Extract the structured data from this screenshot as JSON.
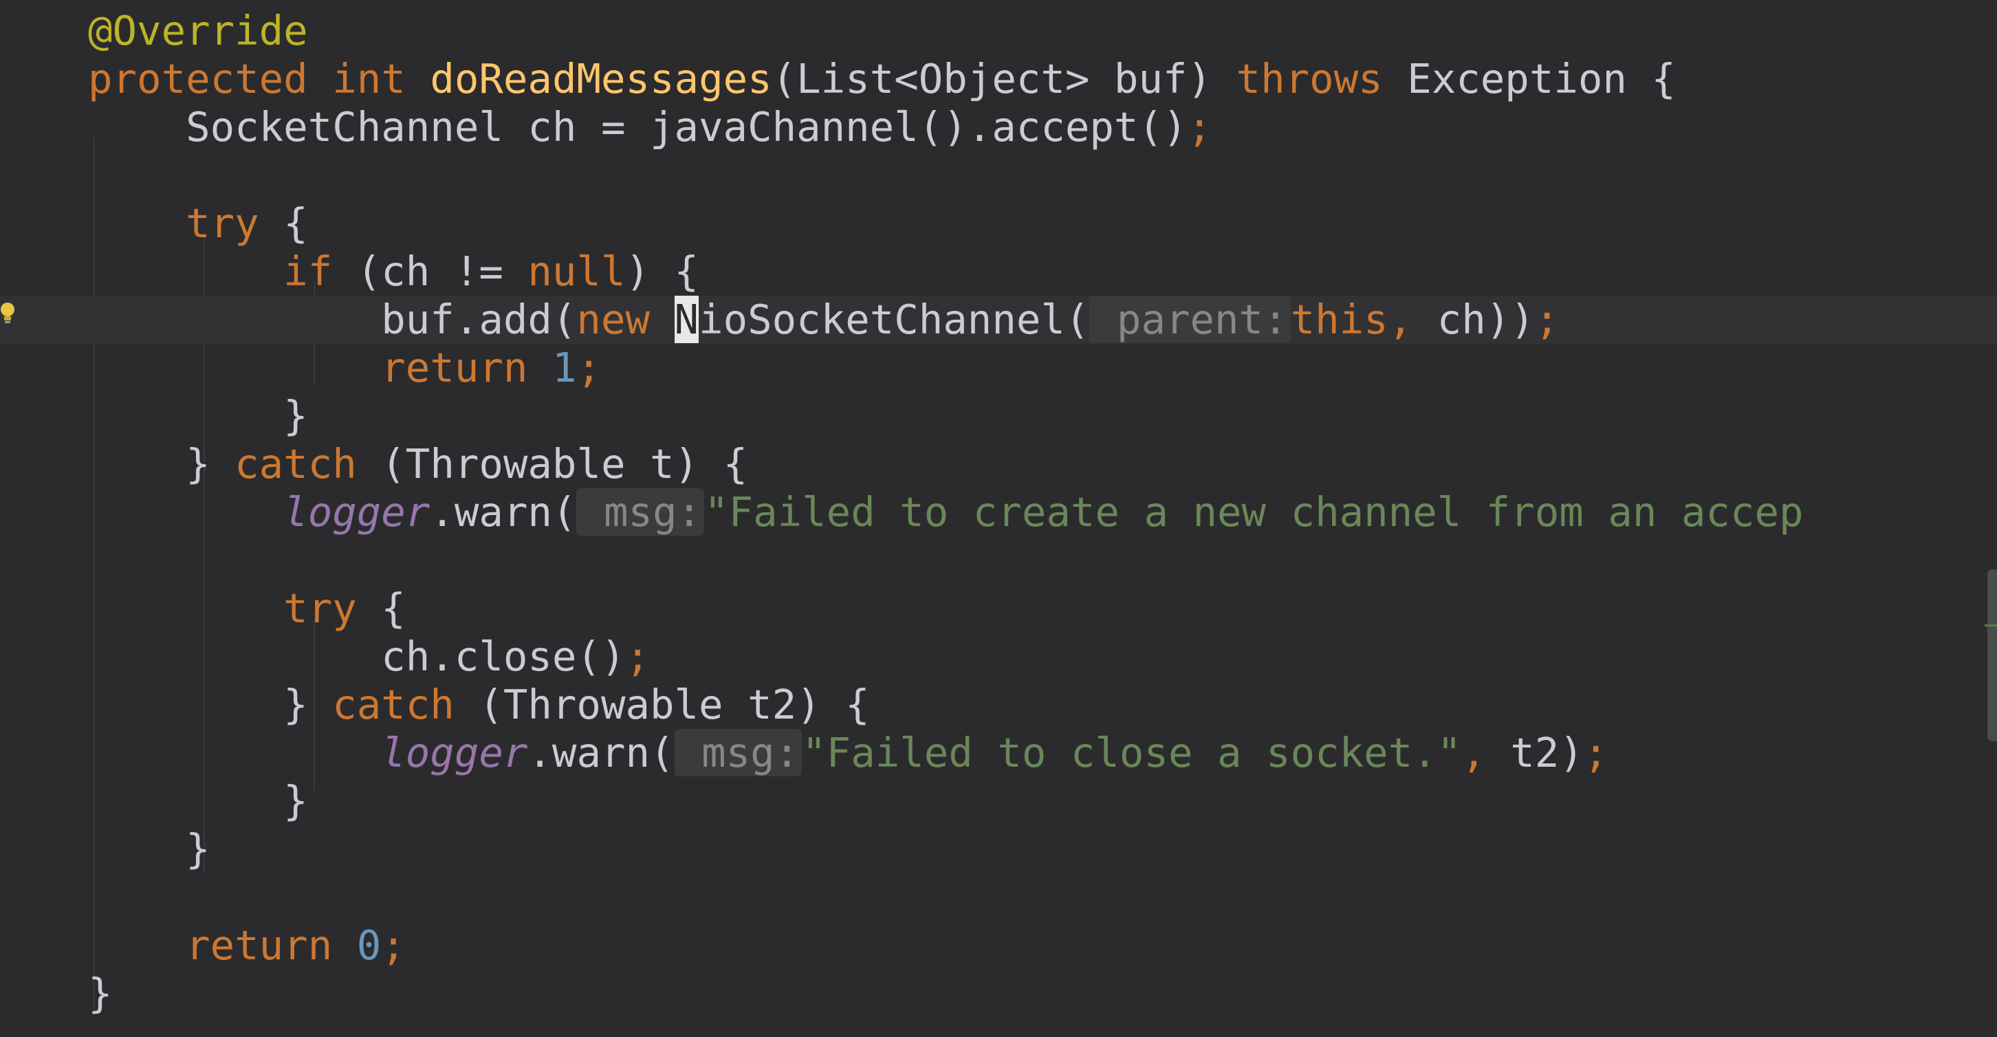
{
  "editor": {
    "language": "Java",
    "lines": [
      {
        "tokens": [
          {
            "text": "@Override",
            "type": "annotation"
          }
        ]
      },
      {
        "tokens": [
          {
            "text": "protected",
            "type": "keyword"
          },
          {
            "text": " ",
            "type": "plain"
          },
          {
            "text": "int",
            "type": "keyword"
          },
          {
            "text": " ",
            "type": "plain"
          },
          {
            "text": "doReadMessages",
            "type": "method-decl"
          },
          {
            "text": "(List<Object> buf) ",
            "type": "plain"
          },
          {
            "text": "throws",
            "type": "keyword"
          },
          {
            "text": " Exception {",
            "type": "plain"
          }
        ]
      },
      {
        "tokens": [
          {
            "text": "    SocketChannel ch = javaChannel().accept()",
            "type": "plain"
          },
          {
            "text": ";",
            "type": "semicolon"
          }
        ]
      },
      {
        "tokens": []
      },
      {
        "tokens": [
          {
            "text": "    ",
            "type": "plain"
          },
          {
            "text": "try",
            "type": "keyword"
          },
          {
            "text": " {",
            "type": "plain"
          }
        ]
      },
      {
        "tokens": [
          {
            "text": "        ",
            "type": "plain"
          },
          {
            "text": "if",
            "type": "keyword"
          },
          {
            "text": " (ch != ",
            "type": "plain"
          },
          {
            "text": "null",
            "type": "keyword"
          },
          {
            "text": ") {",
            "type": "plain"
          }
        ]
      },
      {
        "caret": true,
        "tokens": [
          {
            "text": "            buf.add(",
            "type": "plain"
          },
          {
            "text": "new",
            "type": "keyword"
          },
          {
            "text": " ",
            "type": "plain"
          },
          {
            "text": "N",
            "type": "caret-char"
          },
          {
            "text": "ioSocketChannel(",
            "type": "plain"
          },
          {
            "text": " parent:",
            "type": "param-hint"
          },
          {
            "text": "this",
            "type": "keyword"
          },
          {
            "text": ", ",
            "type": "semicolon"
          },
          {
            "text": "ch))",
            "type": "plain"
          },
          {
            "text": ";",
            "type": "semicolon"
          }
        ]
      },
      {
        "tokens": [
          {
            "text": "            ",
            "type": "plain"
          },
          {
            "text": "return",
            "type": "keyword"
          },
          {
            "text": " ",
            "type": "plain"
          },
          {
            "text": "1",
            "type": "number"
          },
          {
            "text": ";",
            "type": "semicolon"
          }
        ]
      },
      {
        "tokens": [
          {
            "text": "        }",
            "type": "plain"
          }
        ]
      },
      {
        "tokens": [
          {
            "text": "    } ",
            "type": "plain"
          },
          {
            "text": "catch",
            "type": "keyword"
          },
          {
            "text": " (Throwable t) {",
            "type": "plain"
          }
        ]
      },
      {
        "tokens": [
          {
            "text": "        ",
            "type": "plain"
          },
          {
            "text": "logger",
            "type": "static-field"
          },
          {
            "text": ".warn(",
            "type": "plain"
          },
          {
            "text": " msg:",
            "type": "param-hint"
          },
          {
            "text": "\"Failed to create a new channel from an accep",
            "type": "string"
          }
        ]
      },
      {
        "tokens": []
      },
      {
        "tokens": [
          {
            "text": "        ",
            "type": "plain"
          },
          {
            "text": "try",
            "type": "keyword"
          },
          {
            "text": " {",
            "type": "plain"
          }
        ]
      },
      {
        "tokens": [
          {
            "text": "            ch.close()",
            "type": "plain"
          },
          {
            "text": ";",
            "type": "semicolon"
          }
        ]
      },
      {
        "tokens": [
          {
            "text": "        } ",
            "type": "plain"
          },
          {
            "text": "catch",
            "type": "keyword"
          },
          {
            "text": " (Throwable t2) {",
            "type": "plain"
          }
        ]
      },
      {
        "tokens": [
          {
            "text": "            ",
            "type": "plain"
          },
          {
            "text": "logger",
            "type": "static-field"
          },
          {
            "text": ".warn(",
            "type": "plain"
          },
          {
            "text": " msg:",
            "type": "param-hint"
          },
          {
            "text": "\"Failed to close a socket.\"",
            "type": "string"
          },
          {
            "text": ", ",
            "type": "semicolon"
          },
          {
            "text": "t2)",
            "type": "plain"
          },
          {
            "text": ";",
            "type": "semicolon"
          }
        ]
      },
      {
        "tokens": [
          {
            "text": "        }",
            "type": "plain"
          }
        ]
      },
      {
        "tokens": [
          {
            "text": "    }",
            "type": "plain"
          }
        ]
      },
      {
        "tokens": []
      },
      {
        "tokens": [
          {
            "text": "    ",
            "type": "plain"
          },
          {
            "text": "return",
            "type": "keyword"
          },
          {
            "text": " ",
            "type": "plain"
          },
          {
            "text": "0",
            "type": "number"
          },
          {
            "text": ";",
            "type": "semicolon"
          }
        ]
      },
      {
        "tokens": [
          {
            "text": "}",
            "type": "plain"
          }
        ]
      }
    ]
  },
  "gutter": {
    "bulb_icon": "lightbulb-icon",
    "bulb_color": "#e8c547"
  },
  "colors": {
    "background": "#2b2b2d",
    "keyword": "#cc7832",
    "method_declaration": "#ffc66d",
    "string": "#6a8759",
    "number": "#6897bb",
    "static_field": "#9876aa",
    "annotation": "#bbb529",
    "plain": "#c9ccd1"
  }
}
